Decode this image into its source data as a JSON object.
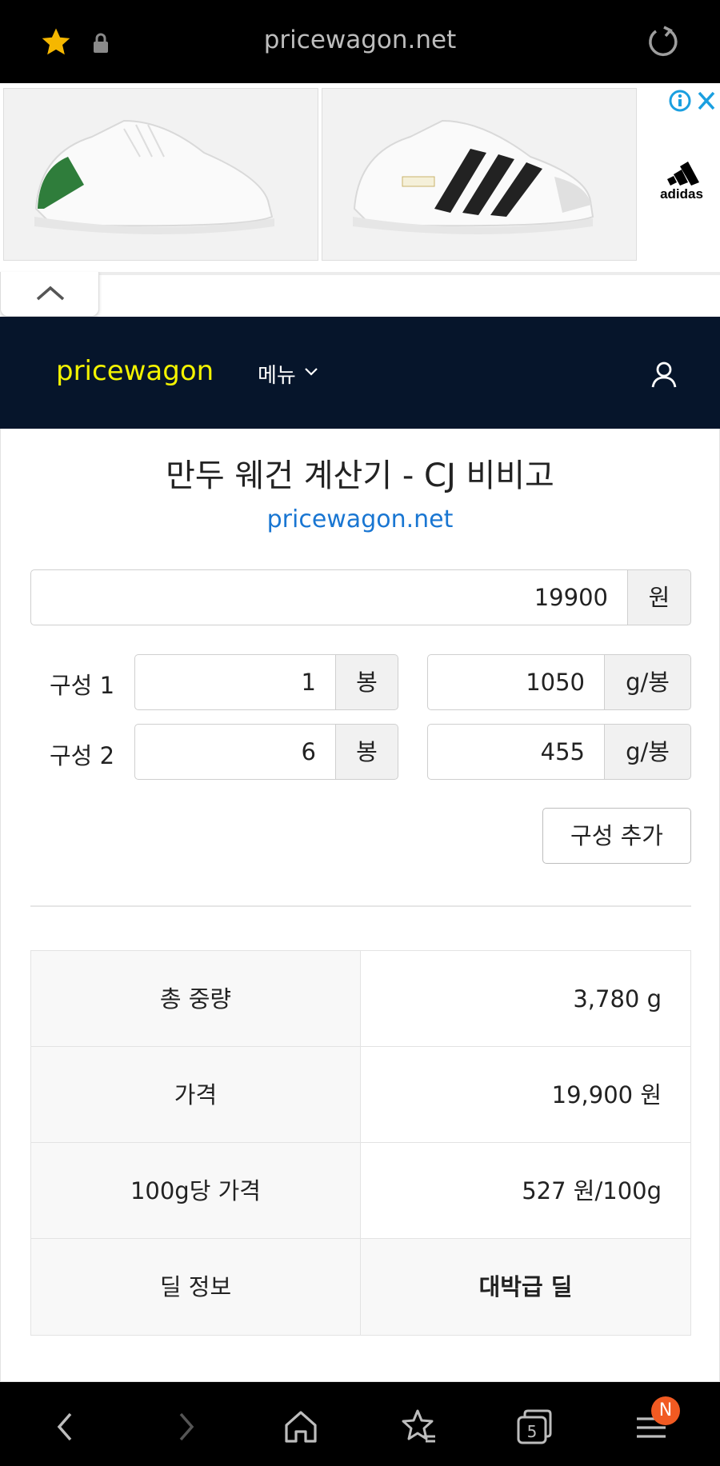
{
  "browser": {
    "url": "pricewagon.net",
    "tab_count": "5",
    "notification_badge": "N"
  },
  "ad": {
    "brand": "adidas"
  },
  "header": {
    "logo": "pricewagon",
    "menu_label": "메뉴"
  },
  "page": {
    "title": "만두 웨건 계산기 - CJ 비비고",
    "subtitle": "pricewagon.net"
  },
  "form": {
    "price_value": "19900",
    "price_unit": "원",
    "rows": [
      {
        "label": "구성 1",
        "count": "1",
        "count_unit": "봉",
        "weight": "1050",
        "weight_unit": "g/봉"
      },
      {
        "label": "구성 2",
        "count": "6",
        "count_unit": "봉",
        "weight": "455",
        "weight_unit": "g/봉"
      }
    ],
    "add_button": "구성 추가"
  },
  "results": [
    {
      "key": "총 중량",
      "value": "3,780 g"
    },
    {
      "key": "가격",
      "value": "19,900 원"
    },
    {
      "key": "100g당 가격",
      "value": "527 원/100g"
    },
    {
      "key": "딜 정보",
      "value": "대박급 딜"
    }
  ],
  "colors": {
    "header_bg": "#06152b",
    "logo": "#f3f300",
    "link": "#1976d2",
    "star": "#f5b700",
    "badge": "#f15a22"
  }
}
